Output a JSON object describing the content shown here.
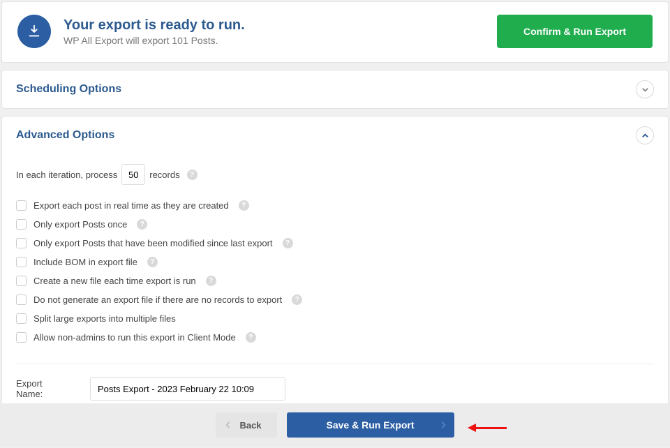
{
  "header": {
    "title": "Your export is ready to run.",
    "subtitle": "WP All Export will export 101 Posts.",
    "confirm_label": "Confirm & Run Export"
  },
  "scheduling": {
    "title": "Scheduling Options"
  },
  "advanced": {
    "title": "Advanced Options",
    "iter_prefix": "In each iteration, process",
    "iter_value": "50",
    "iter_suffix": "records",
    "options": [
      {
        "label": "Export each post in real time as they are created",
        "help": true
      },
      {
        "label": "Only export Posts once",
        "help": true
      },
      {
        "label": "Only export Posts that have been modified since last export",
        "help": true
      },
      {
        "label": "Include BOM in export file",
        "help": true
      },
      {
        "label": "Create a new file each time export is run",
        "help": true
      },
      {
        "label": "Do not generate an export file if there are no records to export",
        "help": true
      },
      {
        "label": "Split large exports into multiple files",
        "help": false
      },
      {
        "label": "Allow non-admins to run this export in Client Mode",
        "help": true
      }
    ],
    "export_name_label": "Export Name:",
    "export_name_value": "Posts Export - 2023 February 22 10:09"
  },
  "footer": {
    "back_label": "Back",
    "save_label": "Save & Run Export"
  }
}
